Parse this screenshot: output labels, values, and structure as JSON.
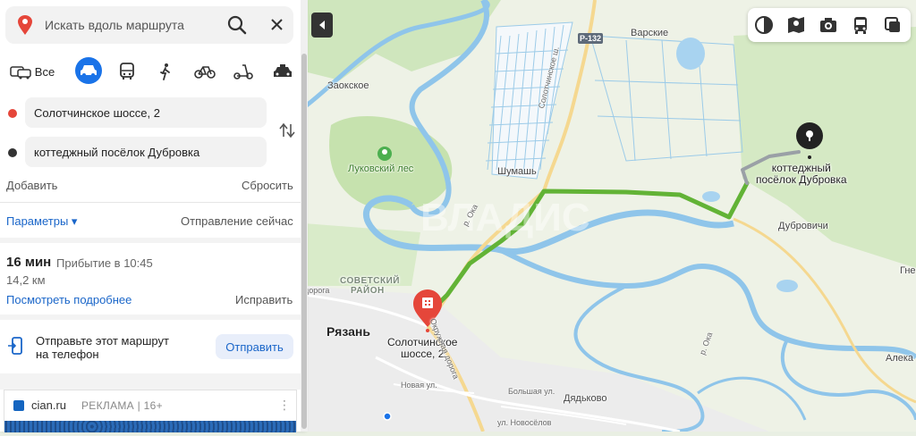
{
  "search": {
    "placeholder": "Искать вдоль маршрута"
  },
  "modes": {
    "all_label": "Все"
  },
  "route": {
    "from": "Солотчинское шоссе, 2",
    "to": "коттеджный посёлок Дубровка",
    "add_label": "Добавить",
    "reset_label": "Сбросить",
    "params_label": "Параметры ▾",
    "departure_label": "Отправление сейчас"
  },
  "summary": {
    "duration": "16 мин",
    "arrival": "Прибытие в 10:45",
    "distance": "14,2 км",
    "details_link": "Посмотреть подробнее",
    "fix_link": "Исправить"
  },
  "send": {
    "text_line1": "Отправьте этот маршрут",
    "text_line2": "на телефон",
    "button": "Отправить"
  },
  "ad": {
    "site": "cian.ru",
    "label": "РЕКЛАМА | 16+",
    "more": "⋮"
  },
  "map": {
    "labels": {
      "varskie": "Варские",
      "zaokskoe": "Заокское",
      "lukovsky": "Луковский лес",
      "shumash": "Шумашь",
      "dest_line1": "коттеджный",
      "dest_line2": "посёлок Дубровка",
      "dubrovichi": "Дубровичи",
      "sovetsky1": "СОВЕТСКИЙ",
      "sovetsky2": "РАЙОН",
      "ryazan": "Рязань",
      "start_line1": "Солотчинское",
      "start_line2": "шоссе, 2",
      "dyadkovo": "Дядьково",
      "r132": "Р-132",
      "solot_sh": "Солотчинское ш.",
      "oka1": "р. Ока",
      "oka2": "р. Ока",
      "okr_doroga": "Окружная дорога",
      "novaya": "Новая ул.",
      "bolshaya": "Большая ул.",
      "novoselov": "ул. Новосёлов",
      "rovga": "дорога",
      "gne": "Гне",
      "aleka": "Алека"
    },
    "watermark": "ВЛАДИС",
    "colors": {
      "route": "#62b336",
      "route_grey": "#9aa0a6",
      "water": "#a8d3f0",
      "forest": "#c9e3b3",
      "pin": "#e5463a"
    }
  }
}
